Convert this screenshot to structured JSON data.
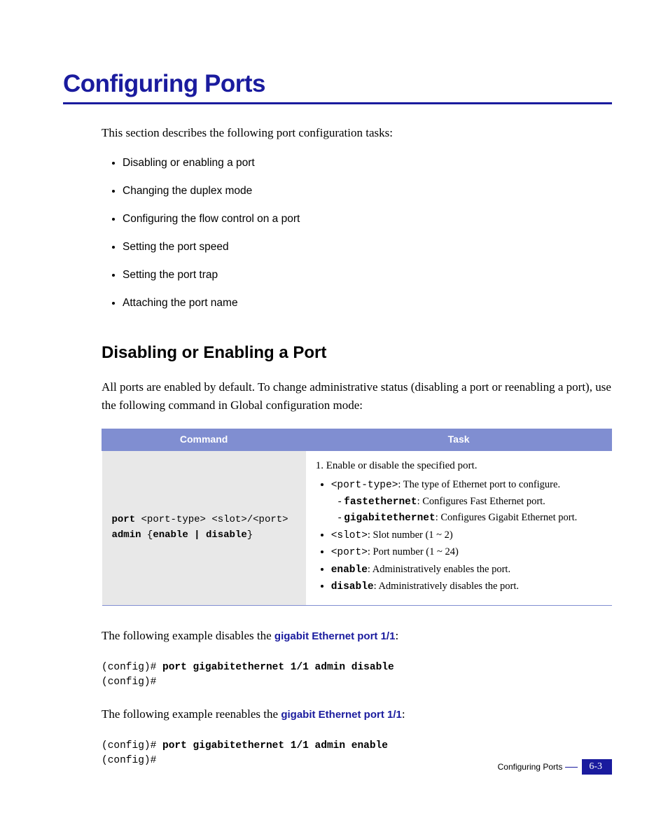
{
  "title": "Configuring Ports",
  "intro": "This section describes the following port configuration tasks:",
  "tasks": [
    "Disabling or enabling a port",
    "Changing the duplex mode",
    "Configuring the flow control on a port",
    "Setting the port speed",
    "Setting the port trap",
    "Attaching the port name"
  ],
  "subheading": "Disabling or Enabling a Port",
  "sub_intro": "All ports are enabled by default. To change administrative status (disabling a port or reenabling a port), use the following command in Global configuration mode:",
  "table": {
    "head_command": "Command",
    "head_task": "Task",
    "command_html": {
      "l1a": "port",
      "l1b": " <port-type> <slot>",
      "l1c": "/",
      "l1d": "<port>",
      "l2a": "admin",
      "l2b": " {",
      "l2c": "enable | disable",
      "l2d": "}"
    },
    "task": {
      "lead": "1. Enable or disable the specified port.",
      "pt_code": "<port-type>",
      "pt_text": ": The type of Ethernet port to configure.",
      "fe_code": "fastethernet",
      "fe_text": ": Configures Fast Ethernet port.",
      "ge_code": "gigabitethernet",
      "ge_text": ": Configures Gigabit Ethernet port.",
      "slot_code": "<slot>",
      "slot_text": ": Slot number (1 ~ 2)",
      "port_code": "<port>",
      "port_text": ": Port number (1 ~ 24)",
      "en_code": "enable",
      "en_text": ": Administratively enables the port.",
      "di_code": "disable",
      "di_text": ": Administratively disables the port."
    }
  },
  "ex1_pre": "The following example disables the ",
  "ex1_emph": "gigabit Ethernet port 1/1",
  "ex1_post": ":",
  "ex1_code": {
    "p1a": "(config)# ",
    "p1b": "port gigabitethernet 1/1 admin disable",
    "p2": "(config)#"
  },
  "ex2_pre": "The following example reenables the ",
  "ex2_emph": "gigabit Ethernet port 1/1",
  "ex2_post": ":",
  "ex2_code": {
    "p1a": "(config)# ",
    "p1b": "port gigabitethernet 1/1 admin enable",
    "p2": "(config)#"
  },
  "footer": {
    "text": "Configuring Ports",
    "pagenum": "6-3"
  }
}
